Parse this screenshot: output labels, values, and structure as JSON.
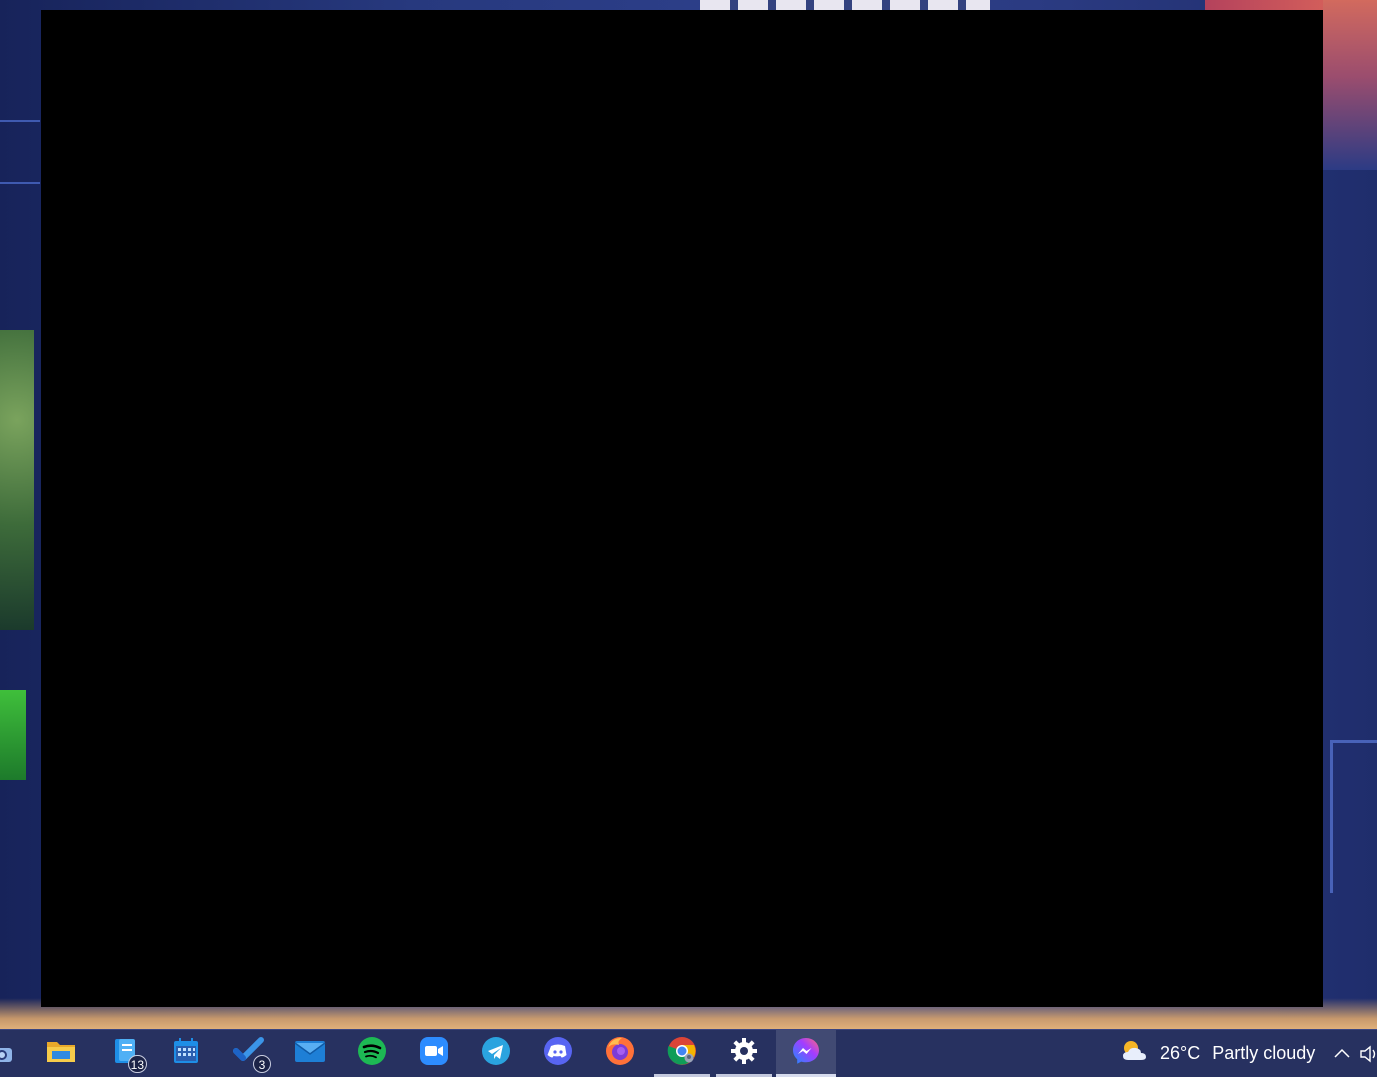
{
  "taskbar": {
    "apps": [
      {
        "id": "camera",
        "icon": "camera-icon"
      },
      {
        "id": "file-explorer",
        "icon": "folder-icon"
      },
      {
        "id": "notes",
        "icon": "notes-icon",
        "badge": "13"
      },
      {
        "id": "calendar",
        "icon": "calendar-icon"
      },
      {
        "id": "todo",
        "icon": "checkmark-icon",
        "badge": "3"
      },
      {
        "id": "mail",
        "icon": "mail-icon"
      },
      {
        "id": "spotify",
        "icon": "spotify-icon"
      },
      {
        "id": "zoom",
        "icon": "video-camera-icon"
      },
      {
        "id": "telegram",
        "icon": "telegram-icon"
      },
      {
        "id": "discord",
        "icon": "discord-icon"
      },
      {
        "id": "firefox",
        "icon": "firefox-icon"
      },
      {
        "id": "chrome",
        "icon": "chrome-icon",
        "running": true
      },
      {
        "id": "settings",
        "icon": "gear-icon",
        "running": true
      },
      {
        "id": "messenger",
        "icon": "messenger-icon",
        "active": true
      }
    ],
    "weather": {
      "temperature": "26°C",
      "condition": "Partly cloudy",
      "icon": "partly-cloudy-icon"
    }
  },
  "colors": {
    "taskbar_bg": "#273160",
    "window_bg": "#000000",
    "folder_yellow": "#f4c63d",
    "blue_app": "#1e8ee6",
    "spotify_green": "#1db954",
    "zoom_blue": "#2d8cff",
    "telegram_blue": "#2aa3df",
    "discord_blurple": "#5865f2",
    "messenger_purple": "#7b5cff"
  }
}
